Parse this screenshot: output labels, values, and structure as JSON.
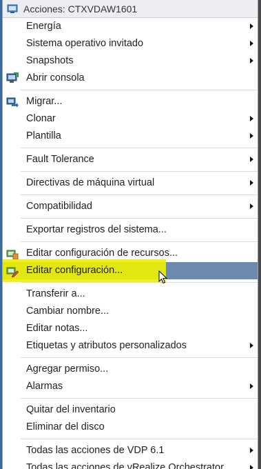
{
  "menu": {
    "title": "Acciones: CTXVDAW1601",
    "groups": [
      [
        {
          "label": "Energía",
          "submenu": true
        },
        {
          "label": "Sistema operativo invitado",
          "submenu": true
        },
        {
          "label": "Snapshots",
          "submenu": true
        },
        {
          "label": "Abrir consola",
          "submenu": false,
          "icon": "console-icon"
        }
      ],
      [
        {
          "label": "Migrar...",
          "submenu": false,
          "icon": "migrate-icon"
        },
        {
          "label": "Clonar",
          "submenu": true
        },
        {
          "label": "Plantilla",
          "submenu": true
        }
      ],
      [
        {
          "label": "Fault Tolerance",
          "submenu": true
        }
      ],
      [
        {
          "label": "Directivas de máquina virtual",
          "submenu": true
        }
      ],
      [
        {
          "label": "Compatibilidad",
          "submenu": true
        }
      ],
      [
        {
          "label": "Exportar registros del sistema...",
          "submenu": false
        }
      ],
      [
        {
          "label": "Editar configuración de recursos...",
          "submenu": false,
          "icon": "resource-settings-icon"
        },
        {
          "label": "Editar configuración...",
          "submenu": false,
          "icon": "edit-settings-icon",
          "hovered": true
        }
      ],
      [
        {
          "label": "Transferir a...",
          "submenu": false
        },
        {
          "label": "Cambiar nombre...",
          "submenu": false
        },
        {
          "label": "Editar notas...",
          "submenu": false
        },
        {
          "label": "Etiquetas y atributos personalizados",
          "submenu": true
        }
      ],
      [
        {
          "label": "Agregar permiso...",
          "submenu": false
        },
        {
          "label": "Alarmas",
          "submenu": true
        }
      ],
      [
        {
          "label": "Quitar del inventario",
          "submenu": false
        },
        {
          "label": "Eliminar del disco",
          "submenu": false
        }
      ],
      [
        {
          "label": "Todas las acciones de VDP 6.1",
          "submenu": true
        },
        {
          "label": "Todas las acciones de vRealize Orchestrator",
          "submenu": true
        }
      ]
    ]
  },
  "colors": {
    "hover_background": "#6c8ab0",
    "highlight_mark": "#f0f000",
    "header_background": "#eceef1"
  }
}
